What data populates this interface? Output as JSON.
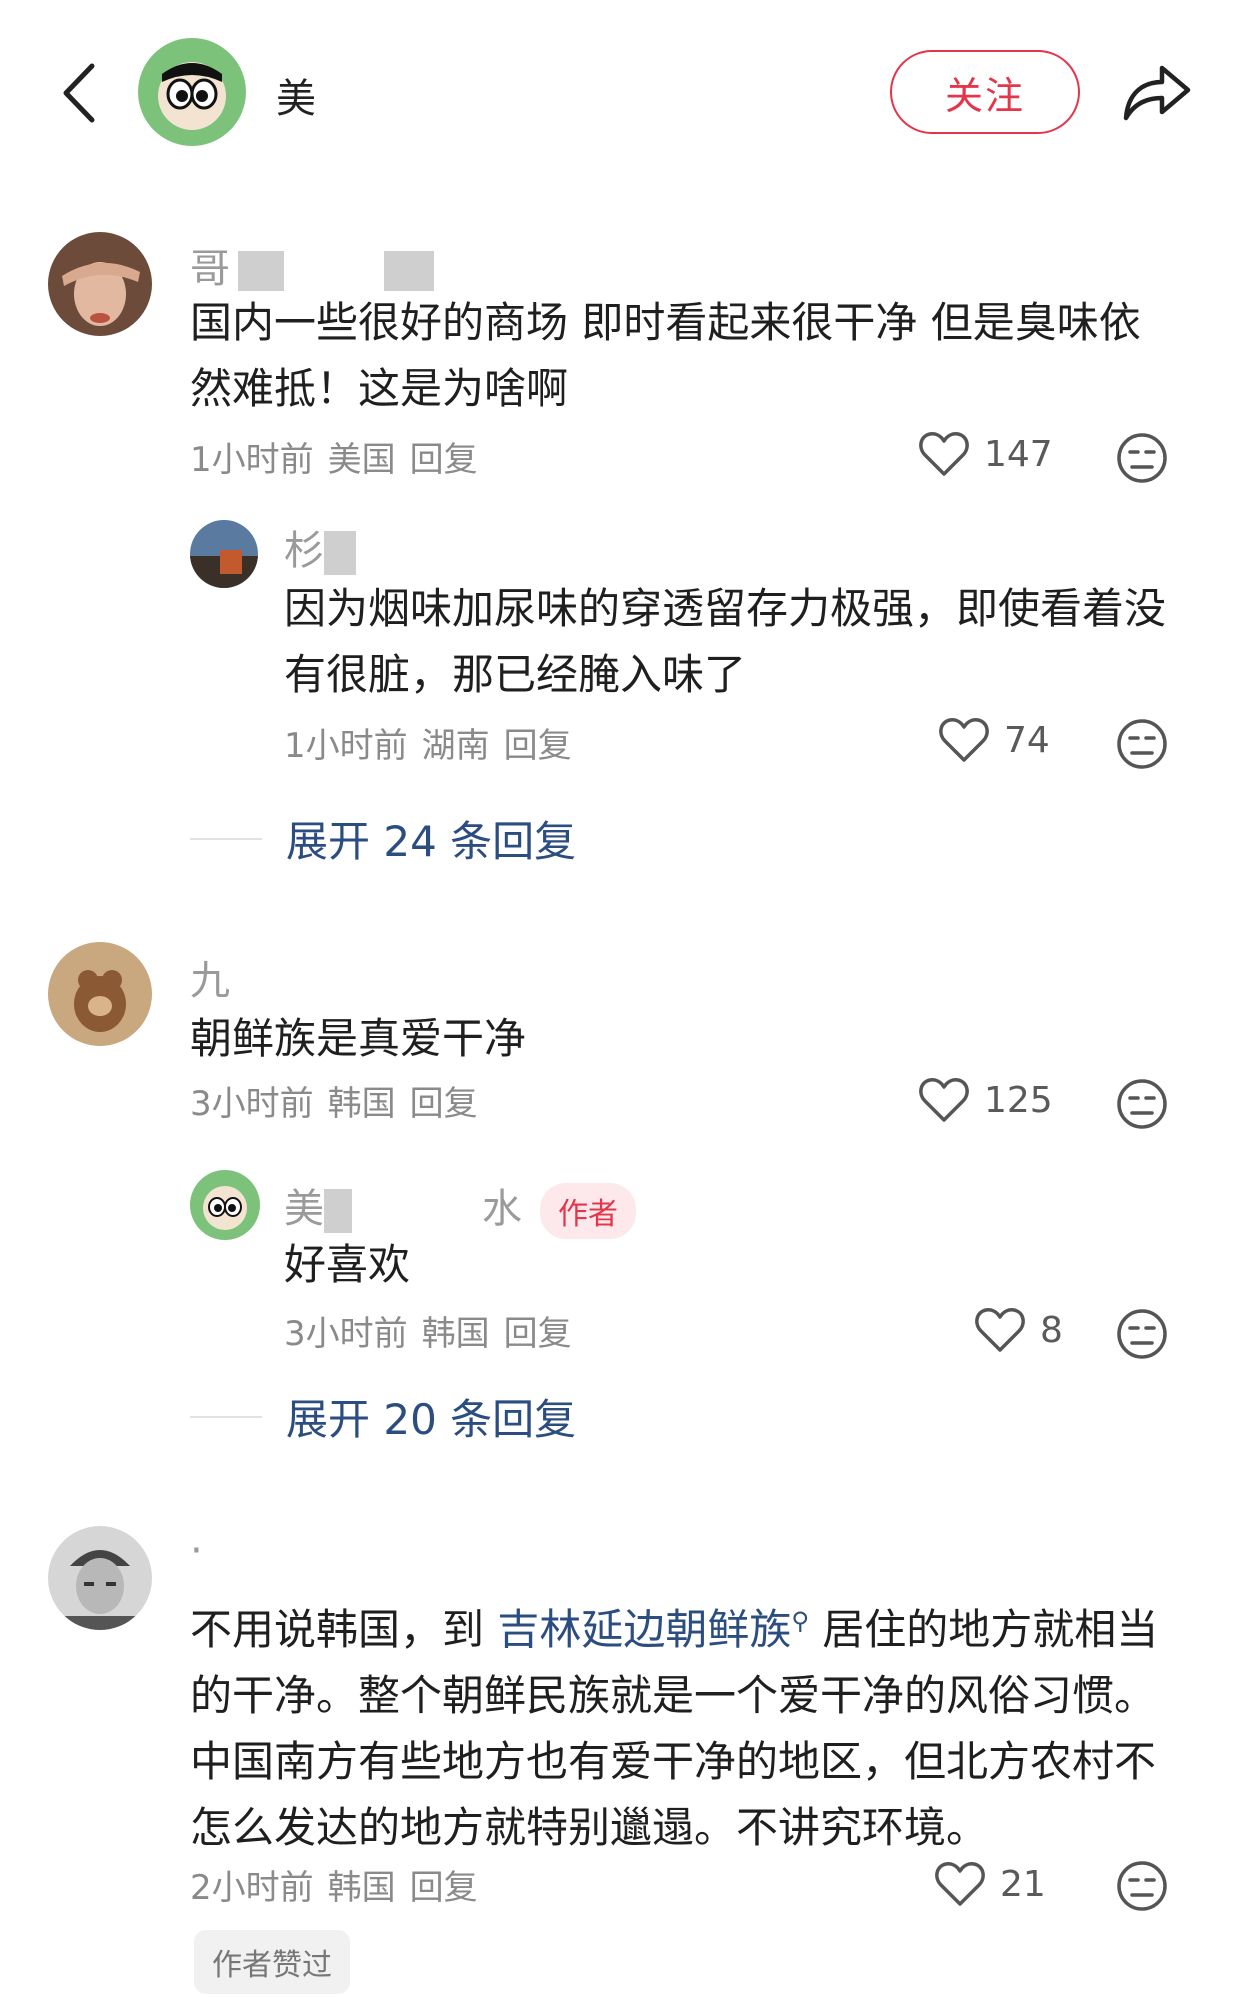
{
  "header": {
    "username": "美",
    "follow_label": "关注",
    "icons": {
      "back": "chevron-left-icon",
      "share": "share-arrow-icon"
    }
  },
  "comments": [
    {
      "username": "哥",
      "text": "国内一些很好的商场 即时看起来很干净 但是臭味依然难抵！这是为啥啊",
      "time": "1小时前",
      "location": "美国",
      "reply_label": "回复",
      "likes": "147"
    },
    {
      "username": "杉",
      "text": "因为烟味加尿味的穿透留存力极强，即使看着没有很脏，那已经腌入味了",
      "time": "1小时前",
      "location": "湖南",
      "reply_label": "回复",
      "likes": "74"
    },
    {
      "username": "九",
      "text": "朝鲜族是真爱干净",
      "time": "3小时前",
      "location": "韩国",
      "reply_label": "回复",
      "likes": "125"
    },
    {
      "username": "美",
      "username_tail": "水",
      "author_badge": "作者",
      "text": "好喜欢",
      "time": "3小时前",
      "location": "韩国",
      "reply_label": "回复",
      "likes": "8"
    },
    {
      "username": "·",
      "text_before": "不用说韩国，到 ",
      "text_link": "吉林延边朝鲜族",
      "text_after": " 居住的地方就相当的干净。整个朝鲜民族就是一个爱干净的风俗习惯。中国南方有些地方也有爱干净的地区，但北方农村不怎么发达的地方就特别邋遢。不讲究环境。",
      "time": "2小时前",
      "location": "韩国",
      "reply_label": "回复",
      "likes": "21",
      "liked_by_author": "作者赞过"
    }
  ],
  "expand": [
    {
      "label": "展开 24 条回复"
    },
    {
      "label": "展开 20 条回复"
    }
  ],
  "colors": {
    "accent_red": "#e5354a",
    "link_blue": "#2b4d80",
    "meta_gray": "#8a8a8a"
  }
}
